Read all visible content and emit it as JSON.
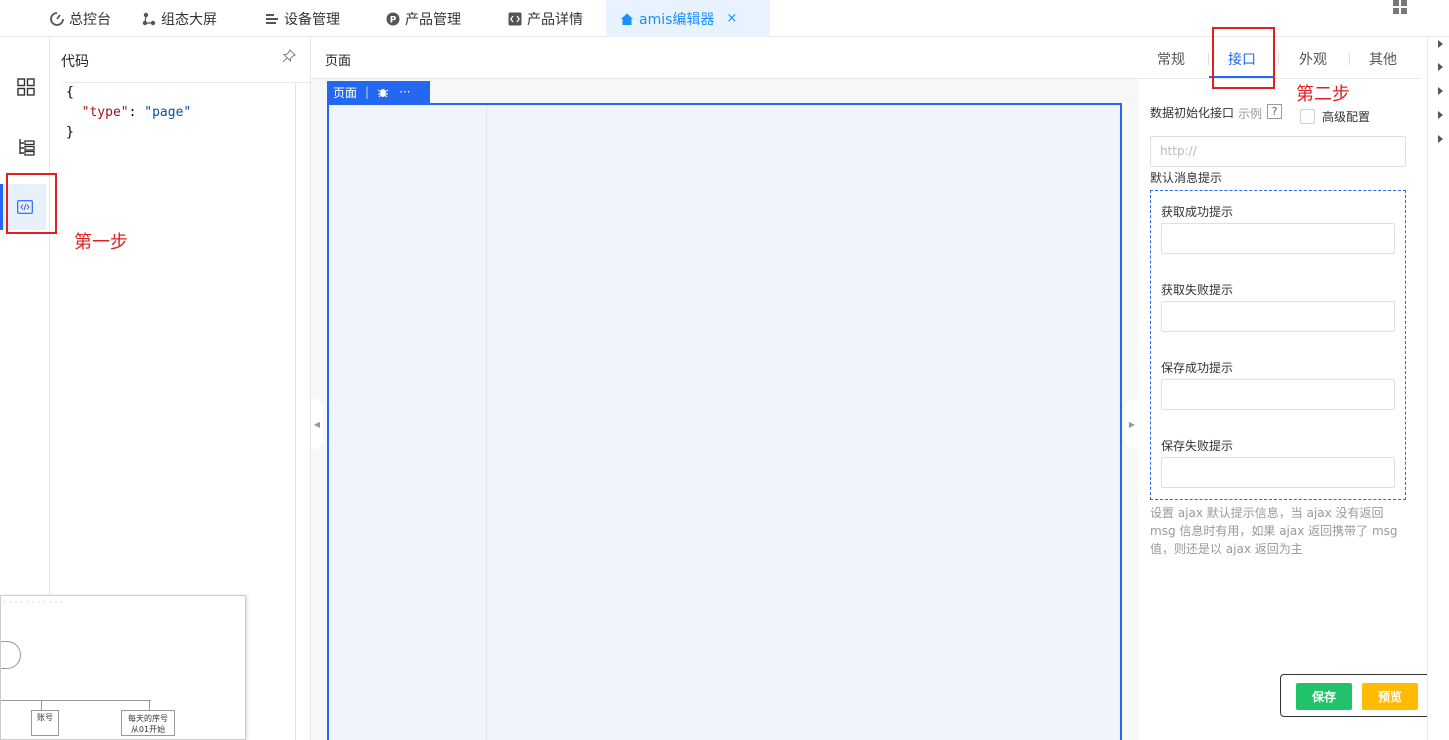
{
  "tabs": [
    {
      "label": "总控台",
      "icon": "dashboard-icon"
    },
    {
      "label": "组态大屏",
      "icon": "nodes-icon"
    },
    {
      "label": "设备管理",
      "icon": "list-icon"
    },
    {
      "label": "产品管理",
      "icon": "product-icon"
    },
    {
      "label": "产品详情",
      "icon": "code-icon"
    },
    {
      "label": "amis编辑器",
      "icon": "home-icon",
      "close": "×"
    }
  ],
  "code_panel": {
    "title": "代码",
    "lines": [
      "{",
      "  \"type\": \"page\"",
      "}"
    ]
  },
  "center": {
    "title": "页面",
    "chip_label": "页面",
    "chip_more": "···"
  },
  "thumbnail": {
    "box1": "账号",
    "box2_line1": "每天的序号",
    "box2_line2": "从01开始"
  },
  "right_panel": {
    "tabs": [
      "常规",
      "接口",
      "外观",
      "其他"
    ],
    "active_tab": "接口",
    "init_api_label": "数据初始化接口",
    "example_label": "示例",
    "help": "?",
    "advanced_label": "高级配置",
    "url_placeholder": "http://",
    "default_msg_label": "默认消息提示",
    "fetch_success_label": "获取成功提示",
    "fetch_failed_label": "获取失败提示",
    "save_success_label": "保存成功提示",
    "save_failed_label": "保存失败提示",
    "description": "设置 ajax 默认提示信息，当 ajax 没有返回 msg 信息时有用，如果 ajax 返回携带了 msg 值，则还是以 ajax 返回为主"
  },
  "actions": {
    "save": "保存",
    "preview": "预览"
  },
  "annotations": {
    "step1": "第一步",
    "step2": "第二步"
  },
  "colors": {
    "primary": "#2468f2",
    "save_button": "#20c26a",
    "preview_button": "#ffbb00",
    "annotation": "#e02020",
    "active_tab_bg": "#e8f3ff"
  }
}
